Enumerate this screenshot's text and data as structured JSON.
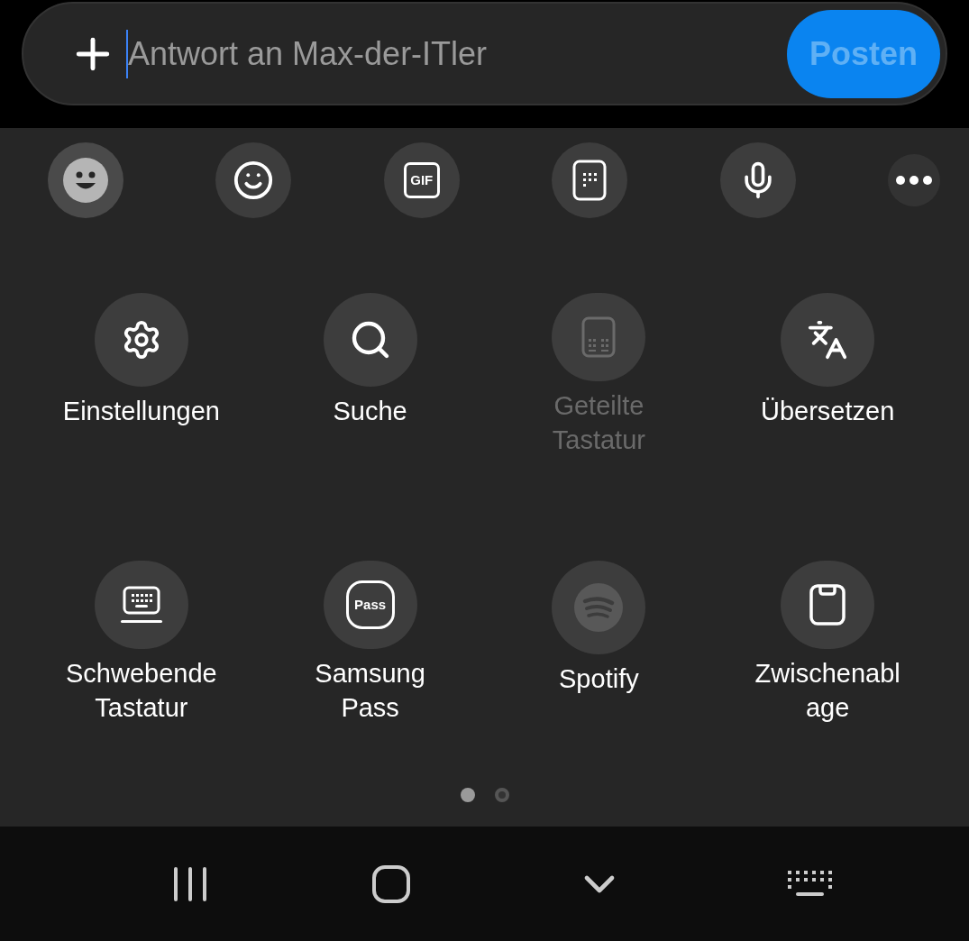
{
  "reply_field": {
    "placeholder": "Antwort an Max-der-ITler"
  },
  "post_button": {
    "label": "Posten",
    "disabled": true
  },
  "toolbar": [
    {
      "kind": "sticker",
      "selected": true
    },
    {
      "kind": "emoji",
      "selected": false
    },
    {
      "kind": "gif",
      "label": "GIF",
      "selected": false
    },
    {
      "kind": "keypad",
      "selected": false
    },
    {
      "kind": "voice",
      "selected": false
    },
    {
      "kind": "more",
      "selected": false
    }
  ],
  "tools": [
    {
      "kind": "settings",
      "lines": [
        "Einstellungen"
      ],
      "disabled": false
    },
    {
      "kind": "search",
      "lines": [
        "Suche"
      ],
      "disabled": false
    },
    {
      "kind": "split",
      "lines": [
        "Geteilte",
        "Tastatur"
      ],
      "disabled": true
    },
    {
      "kind": "translate",
      "lines": [
        "Übersetzen"
      ],
      "disabled": false
    },
    {
      "kind": "floating",
      "lines": [
        "Schwebende",
        "Tastatur"
      ],
      "disabled": false
    },
    {
      "kind": "pass",
      "badge": "Pass",
      "lines": [
        "Samsung",
        "Pass"
      ],
      "disabled": false
    },
    {
      "kind": "spotify",
      "lines": [
        "Spotify"
      ],
      "disabled": false
    },
    {
      "kind": "clipboard",
      "lines": [
        "Zwischenabl",
        "age"
      ],
      "disabled": false
    }
  ],
  "pages": [
    {
      "selected": true
    },
    {
      "selected": false
    }
  ]
}
